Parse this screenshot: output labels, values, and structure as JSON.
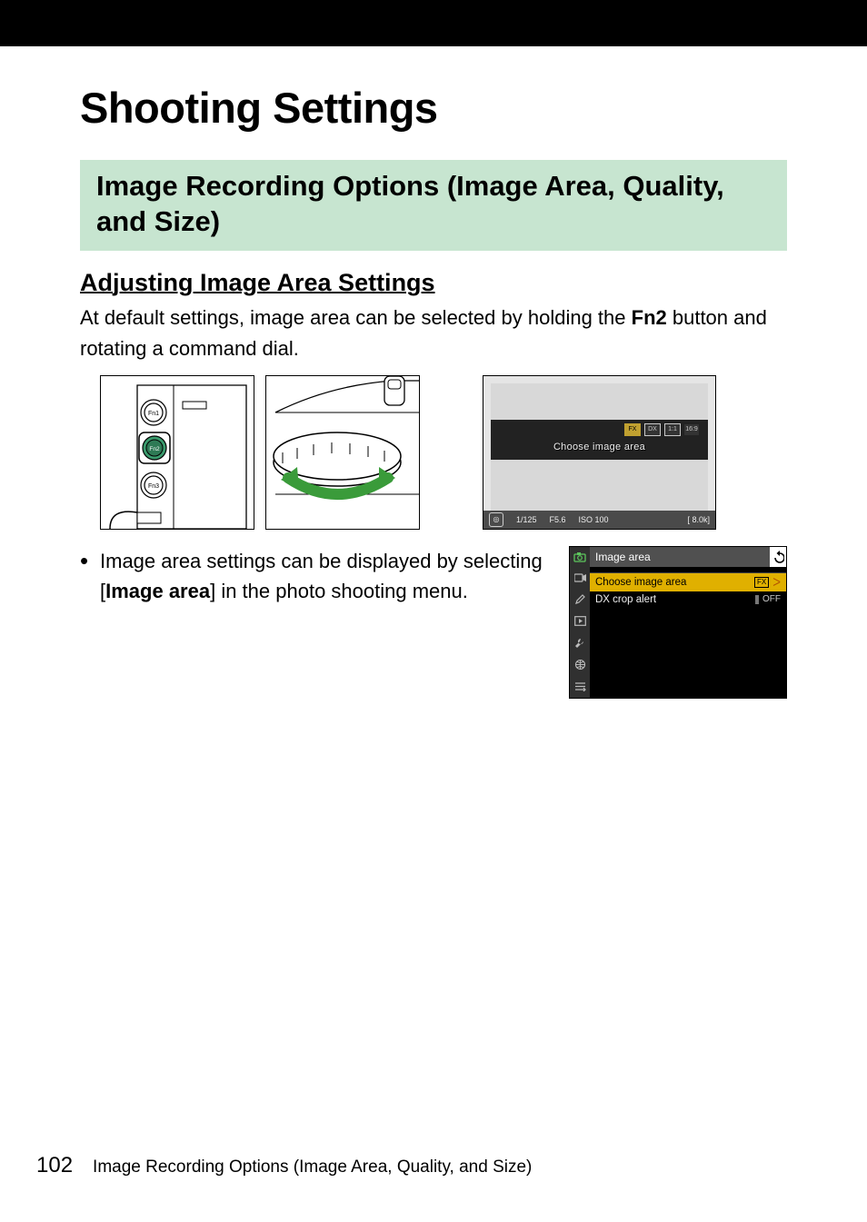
{
  "page": {
    "title": "Shooting Settings",
    "section_title": "Image Recording Options (Image Area, Quality, and Size)",
    "subsection_title": "Adjusting Image Area Settings",
    "intro_pre": "At default settings, image area can be selected by holding the ",
    "intro_fn": "Fn2",
    "intro_post": " button and rotating a command dial.",
    "bullet_pre": "Image area settings can be displayed by selecting [",
    "bullet_bold": "Image area",
    "bullet_post": "] in the photo shooting menu.",
    "page_number": "102",
    "footer_title": "Image Recording Options (Image Area, Quality, and Size)"
  },
  "fn_labels": {
    "fn1": "Fn1",
    "fn2": "Fn2",
    "fn3": "Fn3"
  },
  "lcd": {
    "crop_options": [
      "FX",
      "DX",
      "1:1",
      "16:9"
    ],
    "prompt": "Choose image area",
    "bottom": {
      "icon": "◎",
      "shutter": "1/125",
      "aperture": "F5.6",
      "iso": "ISO 100",
      "remaining": "[ 8.0k]"
    }
  },
  "menu": {
    "title": "Image area",
    "items": [
      {
        "label": "Choose image area",
        "value_badge": "FX",
        "caret": true,
        "selected": true
      },
      {
        "label": "DX crop alert",
        "value": "OFF",
        "selected": false
      }
    ]
  }
}
